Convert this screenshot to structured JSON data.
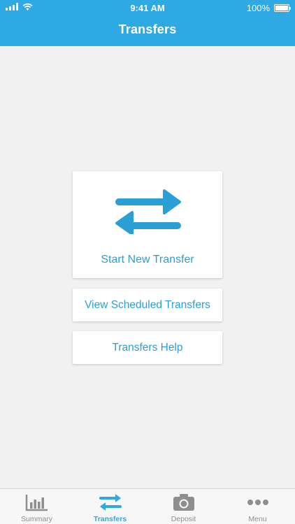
{
  "status_bar": {
    "time": "9:41 AM",
    "battery": "100%"
  },
  "header": {
    "title": "Transfers"
  },
  "main": {
    "start_transfer_label": "Start New Transfer",
    "view_scheduled_label": "View Scheduled Transfers",
    "help_label": "Transfers Help"
  },
  "tabbar": {
    "tabs": [
      {
        "label": "Summary",
        "icon": "chart-icon"
      },
      {
        "label": "Transfers",
        "icon": "transfer-arrows-icon",
        "active": true
      },
      {
        "label": "Deposit",
        "icon": "camera-icon"
      },
      {
        "label": "Menu",
        "icon": "more-dots-icon"
      }
    ]
  },
  "colors": {
    "brand": "#2ea9e3",
    "accent": "#2a9fd6",
    "background": "#f1f1f1",
    "inactive": "#8e8e8e"
  }
}
